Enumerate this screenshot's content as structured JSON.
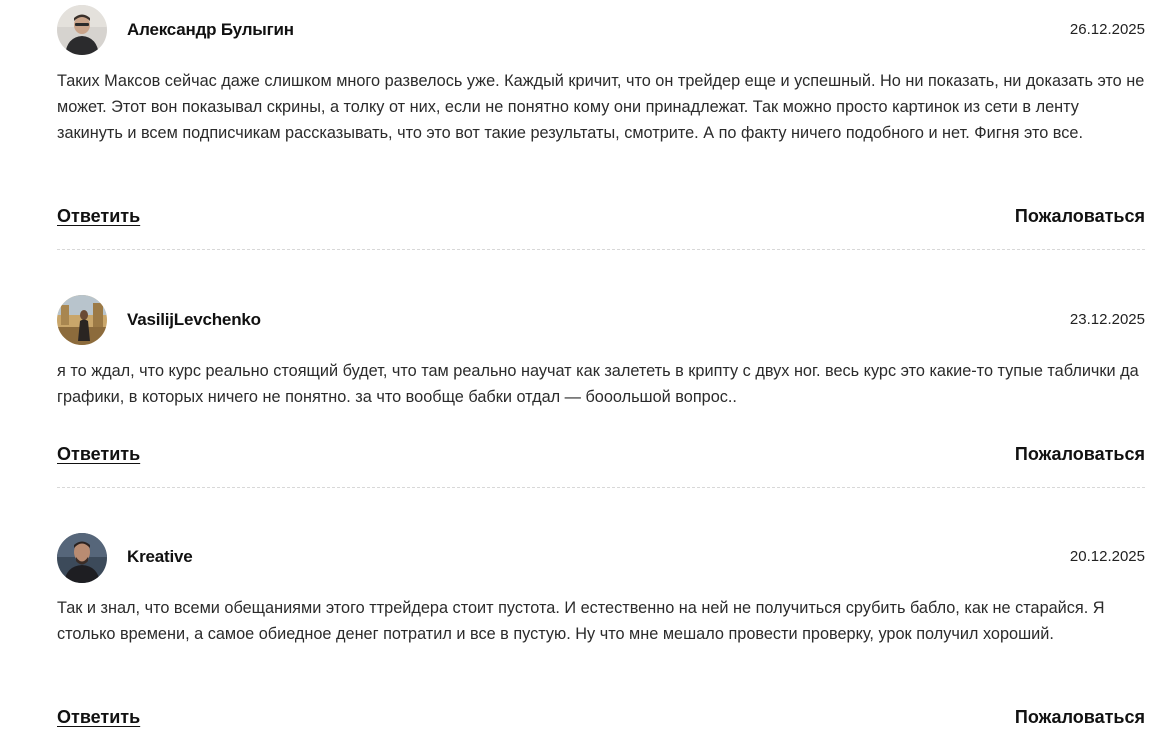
{
  "comments": [
    {
      "author": "Александр Булыгин",
      "date": "26.12.2025",
      "avatar_icon": "user-photo-icon",
      "text": "Таких Максов сейчас даже слишком много развелось уже. Каждый кричит, что он трейдер еще и успешный. Но ни показать, ни доказать это не может. Этот вон показывал скрины, а толку от них, если не понятно кому они принадлежат. Так можно просто картинок из сети в ленту закинуть и всем подписчикам рассказывать, что это вот такие результаты, смотрите. А по факту ничего подобного и нет. Фигня это все.",
      "reply_label": "Ответить",
      "report_label": "Пожаловаться"
    },
    {
      "author": "VasilijLevchenko",
      "date": "23.12.2025",
      "avatar_icon": "user-photo-icon",
      "text": "я то ждал, что курс реально стоящий будет, что там реально научат как залететь в крипту с двух ног. весь курс это какие-то тупые таблички да графики, в которых ничего не понятно. за что вообще бабки отдал — бооольшой вопрос..",
      "reply_label": "Ответить",
      "report_label": "Пожаловаться"
    },
    {
      "author": "Kreative",
      "date": "20.12.2025",
      "avatar_icon": "user-photo-icon",
      "text": "Так и знал, что всеми обещаниями этого ттрейдера стоит пустота. И естественно на ней не получиться срубить бабло, как не старайся. Я столько времени, а самое обиедное денег потратил и все в пустую. Ну что мне мешало провести проверку, урок получил хороший.",
      "reply_label": "Ответить",
      "report_label": "Пожаловаться"
    }
  ],
  "colors": {
    "text": "#2b2b2b",
    "heading": "#111111",
    "divider": "#d8d8d8"
  }
}
